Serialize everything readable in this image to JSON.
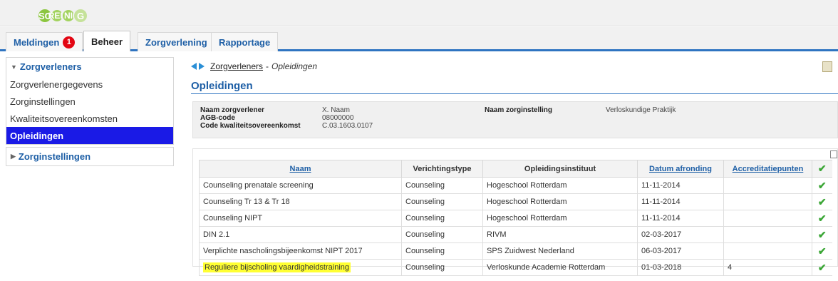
{
  "app": {
    "logo_letters": [
      "SC",
      "REE",
      "NI",
      "G"
    ]
  },
  "nav": {
    "tabs": [
      {
        "label": "Meldingen",
        "badge": "1"
      },
      {
        "label": "Beheer"
      },
      {
        "label": "Zorgverlening"
      },
      {
        "label": "Rapportage"
      }
    ]
  },
  "sidebar": {
    "section1": {
      "title": "Zorgverleners",
      "items": [
        "Zorgverlenergegevens",
        "Zorginstellingen",
        "Kwaliteitsovereenkomsten",
        "Opleidingen"
      ]
    },
    "section2": {
      "title": "Zorginstellingen"
    }
  },
  "breadcrumb": {
    "link": "Zorgverleners",
    "separator": "-",
    "current": "Opleidingen"
  },
  "page_title": "Opleidingen",
  "info": {
    "naam_label": "Naam zorgverlener",
    "naam_value": "X. Naam",
    "agb_label": "AGB-code",
    "agb_value": "08000000",
    "code_label": "Code kwaliteitsovereenkomst",
    "code_value": "C.03.1603.0107",
    "instelling_label": "Naam zorginstelling",
    "instelling_value": "Verloskundige Praktijk"
  },
  "table": {
    "headers": [
      "Naam",
      "Verichtingstype",
      "Opleidingsinstituut",
      "Datum afronding",
      "Accreditatiepunten",
      "✔"
    ],
    "rows": [
      [
        "Counseling prenatale screening",
        "Counseling",
        "Hogeschool Rotterdam",
        "11-11-2014",
        "",
        "✔"
      ],
      [
        "Counseling Tr 13 & Tr 18",
        "Counseling",
        "Hogeschool Rotterdam",
        "11-11-2014",
        "",
        "✔"
      ],
      [
        "Counseling NIPT",
        "Counseling",
        "Hogeschool Rotterdam",
        "11-11-2014",
        "",
        "✔"
      ],
      [
        "DIN 2.1",
        "Counseling",
        "RIVM",
        "02-03-2017",
        "",
        "✔"
      ],
      [
        "Verplichte nascholingsbijeenkomst NIPT 2017",
        "Counseling",
        "SPS Zuidwest Nederland",
        "06-03-2017",
        "",
        "✔"
      ],
      [
        "Reguliere bijscholing vaardigheidstraining",
        "Counseling",
        "Verloskunde Academie Rotterdam",
        "01-03-2018",
        "4",
        "✔"
      ]
    ]
  },
  "colors": {
    "accent": "#1e5fa6",
    "active_sidebar": "#1a1ae6",
    "badge": "#e30613",
    "check": "#3aa635",
    "highlight": "#ffff33"
  }
}
